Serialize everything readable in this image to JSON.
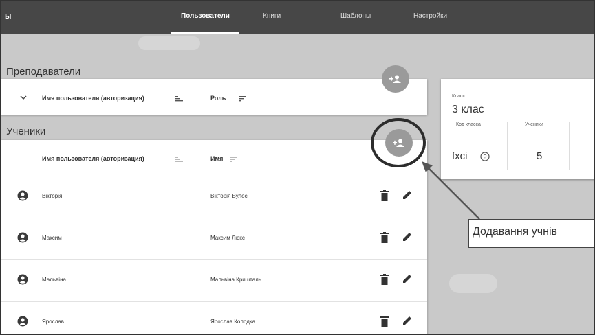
{
  "topbar": {
    "left_text": "ы",
    "tabs": [
      {
        "label": "Пользователи",
        "active": true
      },
      {
        "label": "Книги",
        "active": false
      },
      {
        "label": "Шаблоны",
        "active": false
      },
      {
        "label": "Настройки",
        "active": false
      }
    ]
  },
  "teachers": {
    "title": "Преподаватели",
    "col_username": "Имя пользователя (авторизация)",
    "col_role": "Роль"
  },
  "students": {
    "title": "Ученики",
    "col_username": "Имя пользователя (авторизация)",
    "col_name": "Имя",
    "rows": [
      {
        "username": "Вікторія",
        "name": "Вікторія Булос"
      },
      {
        "username": "Максим",
        "name": "Максим Люкс"
      },
      {
        "username": "Мальвіна",
        "name": "Мальвіна Кришталь"
      },
      {
        "username": "Ярослав",
        "name": "Ярослав Колодка"
      }
    ]
  },
  "class_card": {
    "class_label": "Класс",
    "class_name": "3 клас",
    "code_label": "Код класса",
    "code_value": "fxci",
    "students_label": "Ученики",
    "students_count": "5"
  },
  "callout": {
    "text": "Додавання учнів"
  },
  "colors": {
    "topbar": "#474747",
    "background": "#c9c9c9",
    "fab": "#9a9a9a"
  }
}
